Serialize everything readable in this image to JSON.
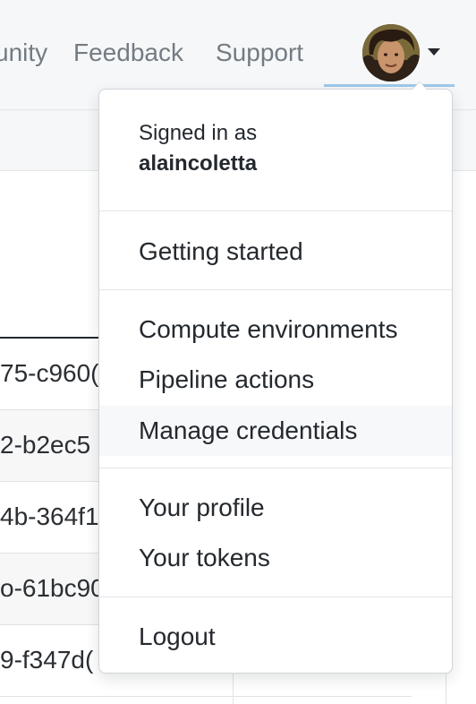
{
  "nav": {
    "links": [
      "unity",
      "Feedback",
      "Support"
    ],
    "accent_color": "#9ccaeb"
  },
  "table": {
    "rows": [
      {
        "id": "75-c960("
      },
      {
        "id": "2-b2ec5"
      },
      {
        "id": "4b-364f1"
      },
      {
        "id": "o-61bc90"
      },
      {
        "id": "9-f347d("
      }
    ]
  },
  "dropdown": {
    "signed_in_label": "Signed in as",
    "username": "alaincoletta",
    "items": {
      "getting_started": "Getting started",
      "compute_environments": "Compute environments",
      "pipeline_actions": "Pipeline actions",
      "manage_credentials": "Manage credentials",
      "your_profile": "Your profile",
      "your_tokens": "Your tokens",
      "logout": "Logout"
    },
    "highlighted_item": "Manage credentials"
  },
  "icons": {
    "avatar": "user-avatar-photo",
    "caret": "caret-down-icon"
  }
}
